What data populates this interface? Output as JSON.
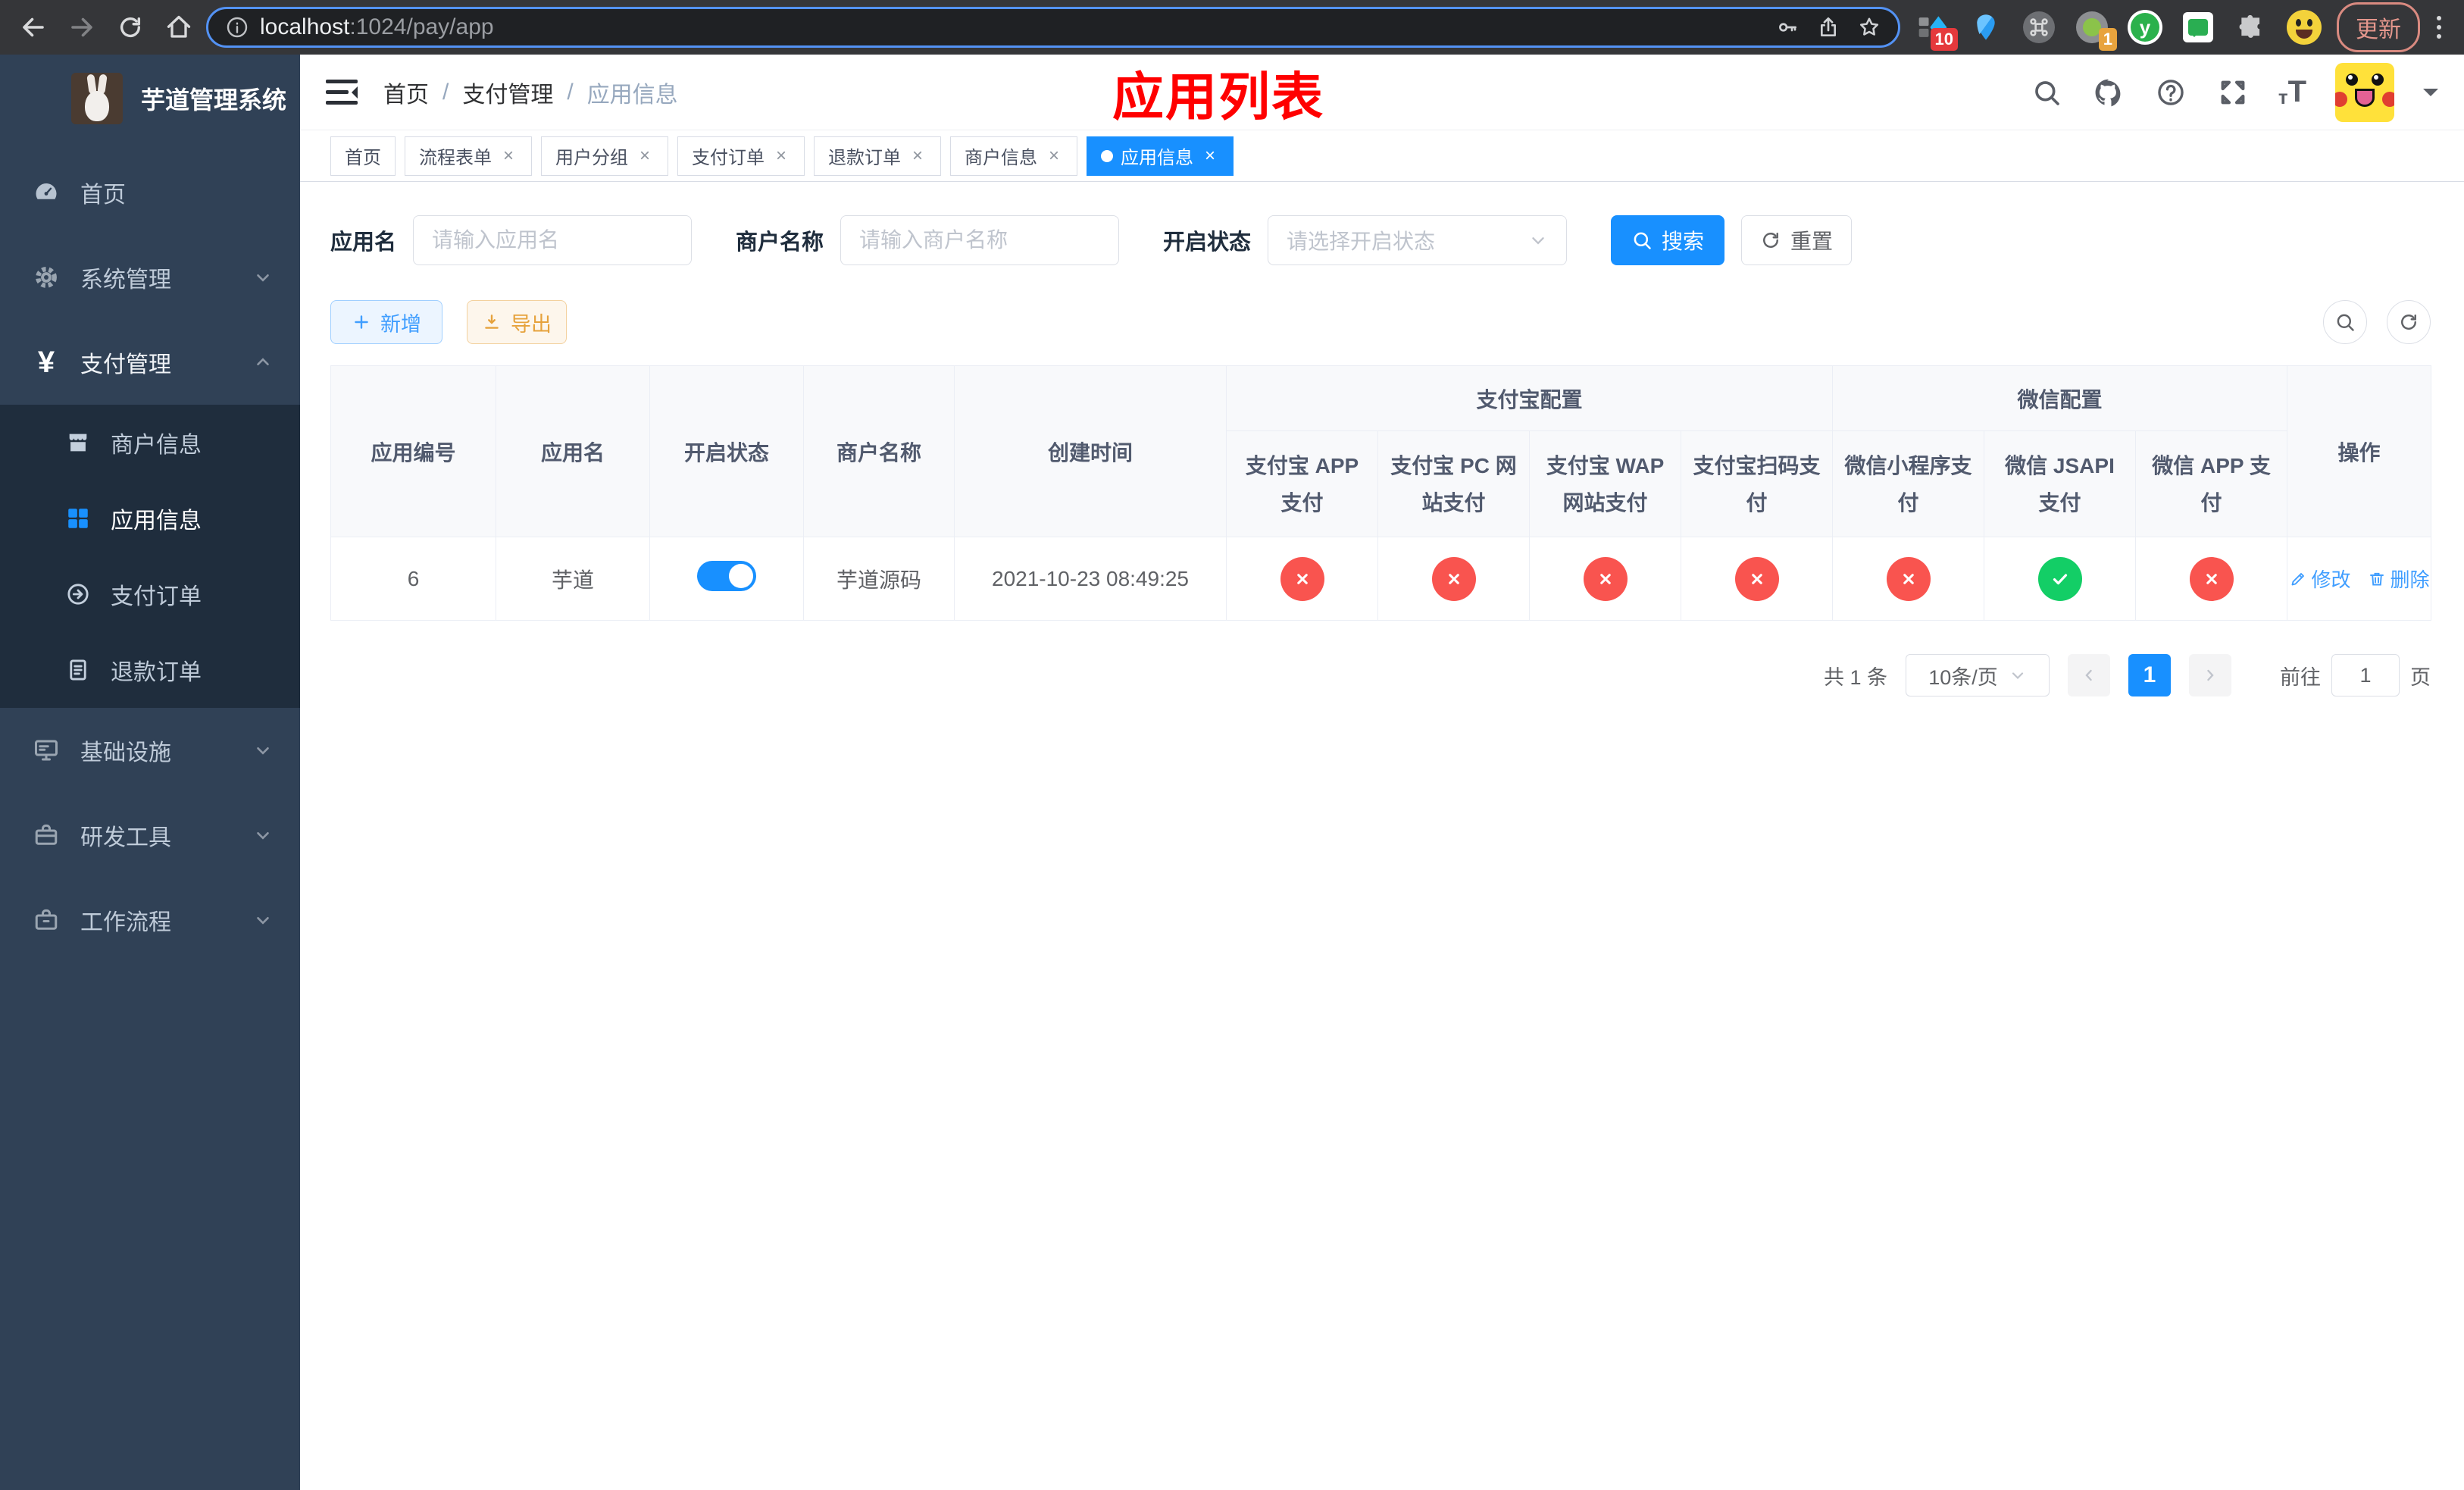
{
  "browser": {
    "url_host": "localhost",
    "url_path": ":1024/pay/app",
    "update_label": "更新",
    "ext_badges": {
      "devtools": "10",
      "session": "1"
    },
    "y_ext_letter": "y"
  },
  "sidebar": {
    "title": "芋道管理系统",
    "menu": [
      {
        "label": "首页"
      },
      {
        "label": "系统管理"
      },
      {
        "label": "支付管理"
      },
      {
        "label": "基础设施"
      },
      {
        "label": "研发工具"
      },
      {
        "label": "工作流程"
      }
    ],
    "submenu": [
      {
        "label": "商户信息"
      },
      {
        "label": "应用信息"
      },
      {
        "label": "支付订单"
      },
      {
        "label": "退款订单"
      }
    ]
  },
  "navbar": {
    "breadcrumb": [
      {
        "label": "首页"
      },
      {
        "label": "支付管理"
      },
      {
        "label": "应用信息"
      }
    ],
    "annotation": "应用列表"
  },
  "tabs": [
    {
      "label": "首页"
    },
    {
      "label": "流程表单"
    },
    {
      "label": "用户分组"
    },
    {
      "label": "支付订单"
    },
    {
      "label": "退款订单"
    },
    {
      "label": "商户信息"
    },
    {
      "label": "应用信息"
    }
  ],
  "search": {
    "app_name_label": "应用名",
    "app_name_placeholder": "请输入应用名",
    "merchant_label": "商户名称",
    "merchant_placeholder": "请输入商户名称",
    "status_label": "开启状态",
    "status_placeholder": "请选择开启状态",
    "search_button": "搜索",
    "reset_button": "重置"
  },
  "toolbar": {
    "add_label": "新增",
    "export_label": "导出"
  },
  "table": {
    "simple_columns": [
      "应用编号",
      "应用名",
      "开启状态",
      "商户名称",
      "创建时间"
    ],
    "alipay_group": "支付宝配置",
    "alipay_columns": [
      "支付宝 APP 支付",
      "支付宝 PC 网站支付",
      "支付宝 WAP 网站支付",
      "支付宝扫码支付"
    ],
    "wechat_group": "微信配置",
    "wechat_columns": [
      "微信小程序支付",
      "微信 JSAPI 支付",
      "微信 APP 支付"
    ],
    "action_column": "操作",
    "row": {
      "id": "6",
      "name": "芋道",
      "enabled": true,
      "merchant": "芋道源码",
      "created_at": "2021-10-23 08:49:25",
      "pay_statuses": [
        "fail",
        "fail",
        "fail",
        "fail",
        "fail",
        "success",
        "fail"
      ],
      "edit_label": "修改",
      "delete_label": "删除"
    }
  },
  "pagination": {
    "total_label": "共 1 条",
    "page_size_label": "10条/页",
    "current_page": "1",
    "goto_label": "前往",
    "goto_value": "1",
    "goto_suffix": "页"
  },
  "colors": {
    "primary": "#1890ff",
    "success": "#13ce66",
    "danger": "#f9544f",
    "warning": "#e6a23c",
    "annotation_red": "#ff0000",
    "sidebar_bg": "#304156",
    "submenu_bg": "#1f2d3d"
  }
}
